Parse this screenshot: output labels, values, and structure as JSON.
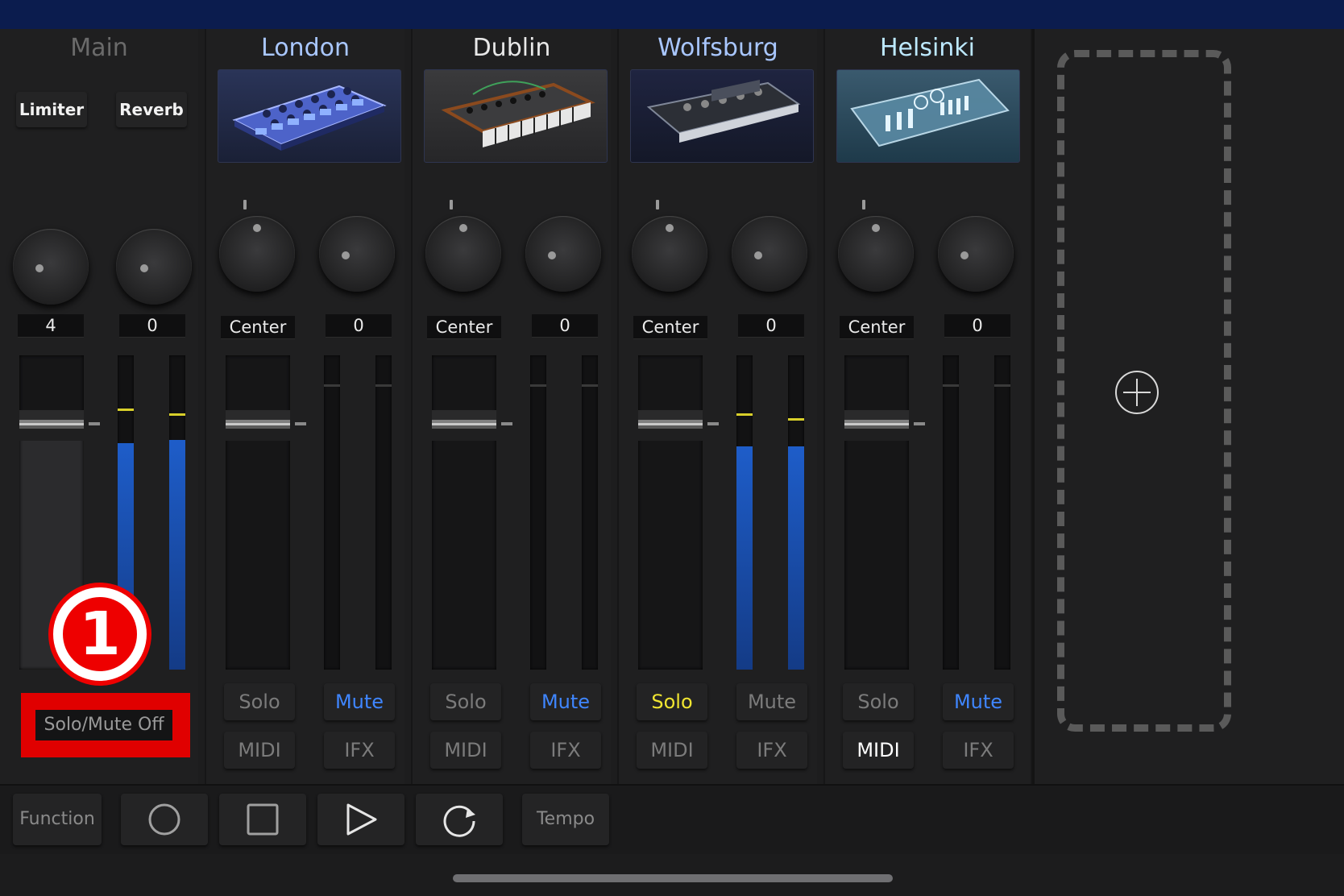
{
  "main": {
    "title": "Main",
    "limiter_label": "Limiter",
    "reverb_label": "Reverb",
    "knob_left_value": "4",
    "knob_right_value": "0",
    "solo_mute_off_label": "Solo/Mute Off",
    "annotation_number": "1",
    "meter_levels": [
      0.72,
      0.73
    ]
  },
  "channels": [
    {
      "name": "London",
      "pan": "Center",
      "send": "0",
      "solo": "Solo",
      "mute": "Mute",
      "midi": "MIDI",
      "ifx": "IFX",
      "solo_on": false,
      "mute_on": true,
      "midi_on": false
    },
    {
      "name": "Dublin",
      "pan": "Center",
      "send": "0",
      "solo": "Solo",
      "mute": "Mute",
      "midi": "MIDI",
      "ifx": "IFX",
      "solo_on": false,
      "mute_on": true,
      "midi_on": false
    },
    {
      "name": "Wolfsburg",
      "pan": "Center",
      "send": "0",
      "solo": "Solo",
      "mute": "Mute",
      "midi": "MIDI",
      "ifx": "IFX",
      "solo_on": true,
      "mute_on": false,
      "midi_on": false,
      "meter_levels": [
        0.71,
        0.71
      ]
    },
    {
      "name": "Helsinki",
      "pan": "Center",
      "send": "0",
      "solo": "Solo",
      "mute": "Mute",
      "midi": "MIDI",
      "ifx": "IFX",
      "solo_on": false,
      "mute_on": true,
      "midi_on": true
    }
  ],
  "transport": {
    "function_label": "Function",
    "tempo_label": "Tempo",
    "record_icon": "record-icon",
    "stop_icon": "stop-icon",
    "play_icon": "play-icon",
    "loop_icon": "loop-icon"
  },
  "add_track_icon": "add-track-icon"
}
